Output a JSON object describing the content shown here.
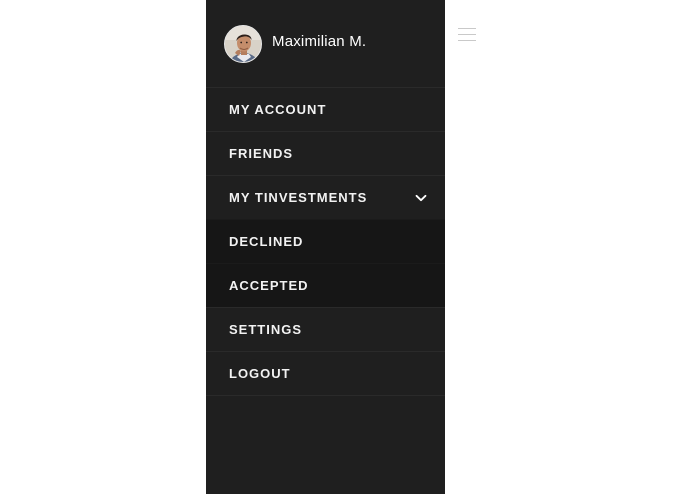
{
  "profile": {
    "name": "Maximilian M."
  },
  "menu": {
    "items": [
      {
        "label": "MY ACCOUNT"
      },
      {
        "label": "FRIENDS"
      },
      {
        "label": "MY TINVESTMENTS"
      },
      {
        "label": "DECLINED"
      },
      {
        "label": "ACCEPTED"
      },
      {
        "label": "SETTINGS"
      },
      {
        "label": "LOGOUT"
      }
    ]
  },
  "icons": {
    "expand": "chevron-down-icon",
    "menu_toggle": "hamburger-icon"
  },
  "colors": {
    "drawer_bg": "#1f1f1f",
    "submenu_bg": "#161616",
    "text": "#f2f2f2",
    "page_bg": "#ffffff"
  }
}
